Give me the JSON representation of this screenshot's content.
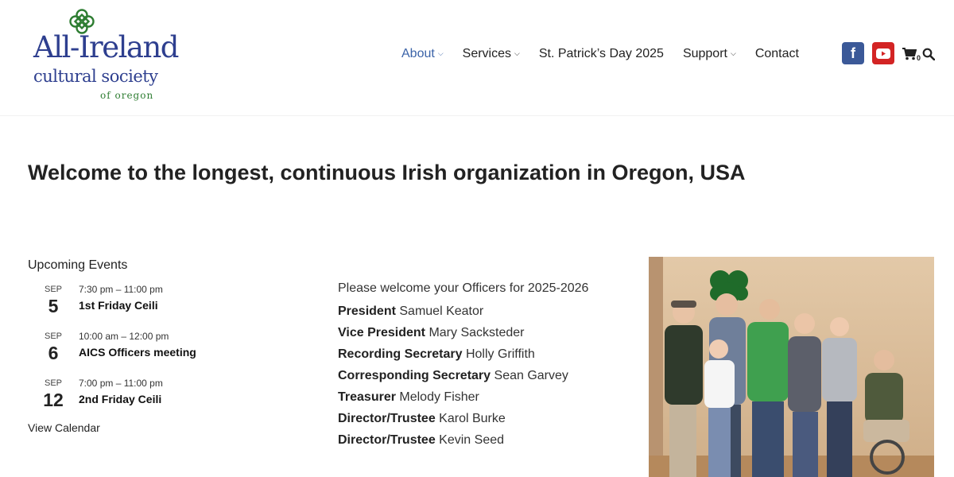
{
  "logo": {
    "line1": "All-Ireland",
    "line2": "cultural society",
    "line3": "of oregon",
    "knot_icon": "celtic-knot-icon",
    "colors": {
      "blue": "#2e3f8f",
      "green": "#2e7d32"
    }
  },
  "nav": {
    "items": [
      {
        "label": "About",
        "dropdown": true,
        "active": true
      },
      {
        "label": "Services",
        "dropdown": true
      },
      {
        "label": "St. Patrick’s Day 2025",
        "dropdown": false
      },
      {
        "label": "Support",
        "dropdown": true
      },
      {
        "label": "Contact",
        "dropdown": false
      }
    ],
    "caret": "⌵",
    "active_color": "#3b63a8"
  },
  "header_icons": {
    "facebook": {
      "icon": "facebook-icon",
      "glyph": "f",
      "color": "#3b5998"
    },
    "youtube": {
      "icon": "youtube-icon",
      "color": "#d32424"
    },
    "cart": {
      "icon": "cart-icon",
      "count": "0"
    },
    "search": {
      "icon": "search-icon"
    }
  },
  "main": {
    "title": "Welcome to the longest, continuous Irish organization in Oregon, USA"
  },
  "events": {
    "heading": "Upcoming Events",
    "items": [
      {
        "month": "SEP",
        "day": "5",
        "time": "7:30 pm – 11:00 pm",
        "name": "1st Friday Ceili"
      },
      {
        "month": "SEP",
        "day": "6",
        "time": "10:00 am – 12:00 pm",
        "name": "AICS Officers meeting"
      },
      {
        "month": "SEP",
        "day": "12",
        "time": "7:00 pm – 11:00 pm",
        "name": "2nd Friday Ceili"
      }
    ],
    "view_calendar": "View Calendar"
  },
  "officers": {
    "intro": "Please welcome your Officers for 2025-2026",
    "list": [
      {
        "role": "President",
        "name": "Samuel Keator"
      },
      {
        "role": "Vice President",
        "name": "Mary Sacksteder"
      },
      {
        "role": "Recording Secretary",
        "name": "Holly Griffith"
      },
      {
        "role": "Corresponding Secretary",
        "name": "Sean Garvey"
      },
      {
        "role": "Treasurer",
        "name": "Melody Fisher"
      },
      {
        "role": "Director/Trustee",
        "name": "Karol Burke"
      },
      {
        "role": "Director/Trustee",
        "name": "Kevin Seed"
      }
    ]
  }
}
